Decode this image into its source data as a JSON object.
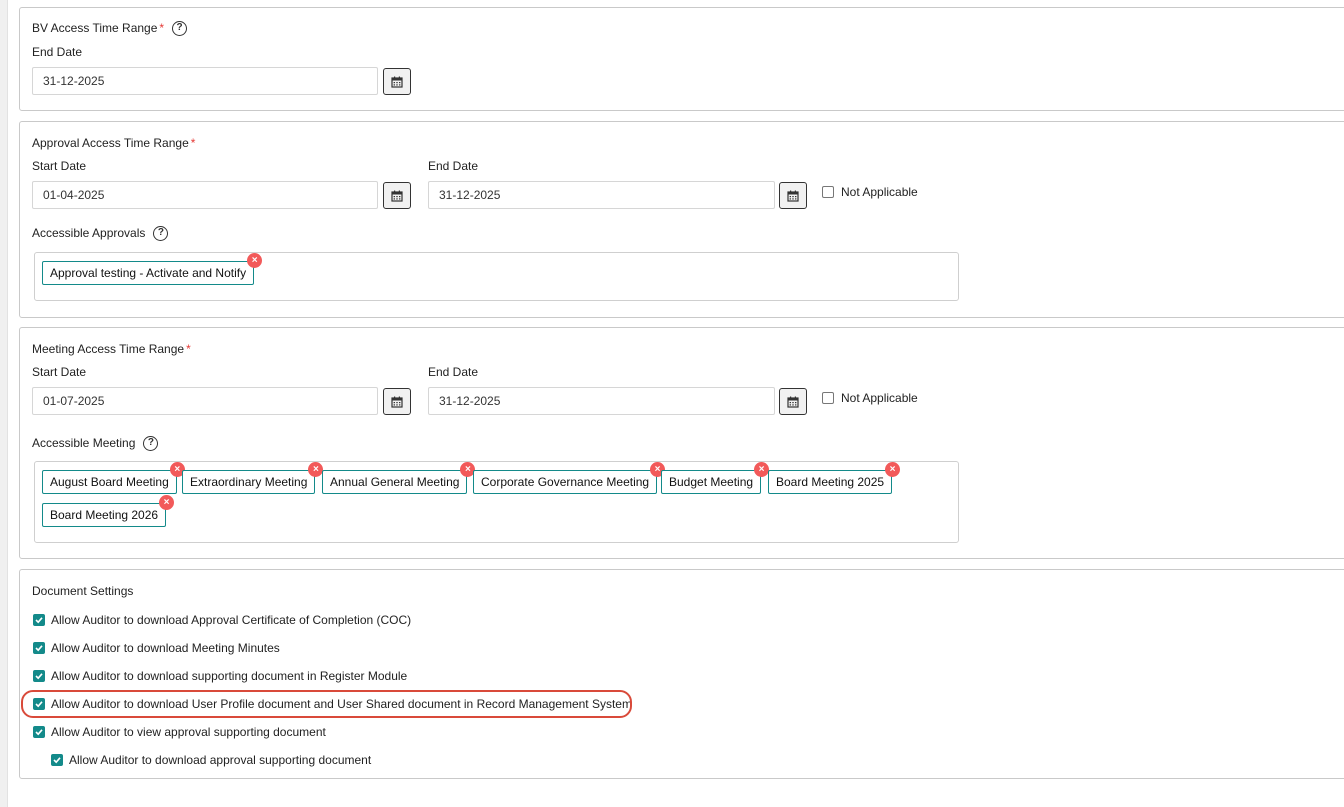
{
  "bv_section": {
    "title": "BV Access Time Range",
    "required_mark": "*",
    "end_date_label": "End Date",
    "end_date_value": "31-12-2025"
  },
  "approval_section": {
    "title": "Approval Access Time Range",
    "required_mark": "*",
    "start_date_label": "Start Date",
    "start_date_value": "01-04-2025",
    "end_date_label": "End Date",
    "end_date_value": "31-12-2025",
    "not_applicable_label": "Not Applicable",
    "accessible_label": "Accessible Approvals",
    "tags": [
      "Approval testing - Activate and Notify"
    ]
  },
  "meeting_section": {
    "title": "Meeting Access Time Range",
    "required_mark": "*",
    "start_date_label": "Start Date",
    "start_date_value": "01-07-2025",
    "end_date_label": "End Date",
    "end_date_value": "31-12-2025",
    "not_applicable_label": "Not Applicable",
    "accessible_label": "Accessible Meeting",
    "tags": [
      "August Board Meeting",
      "Extraordinary Meeting",
      "Annual General Meeting",
      "Corporate Governance Meeting",
      "Budget Meeting",
      "Board Meeting 2025",
      "Board Meeting 2026"
    ]
  },
  "document_section": {
    "title": "Document Settings",
    "options": [
      "Allow Auditor to download Approval Certificate of Completion (COC)",
      "Allow Auditor to download Meeting Minutes",
      "Allow Auditor to download supporting document in Register Module",
      "Allow Auditor to download User Profile document and User Shared document in Record Management System",
      "Allow Auditor to view approval supporting document",
      "Allow Auditor to download approval supporting document"
    ]
  },
  "icons": {
    "help": "help-circle-icon",
    "calendar": "calendar-icon",
    "remove": "close-icon",
    "check": "checkmark-icon"
  },
  "colors": {
    "accent": "#138a8a",
    "remove_badge": "#f25a5a",
    "required": "#e53935",
    "highlight": "#d94a3a"
  }
}
